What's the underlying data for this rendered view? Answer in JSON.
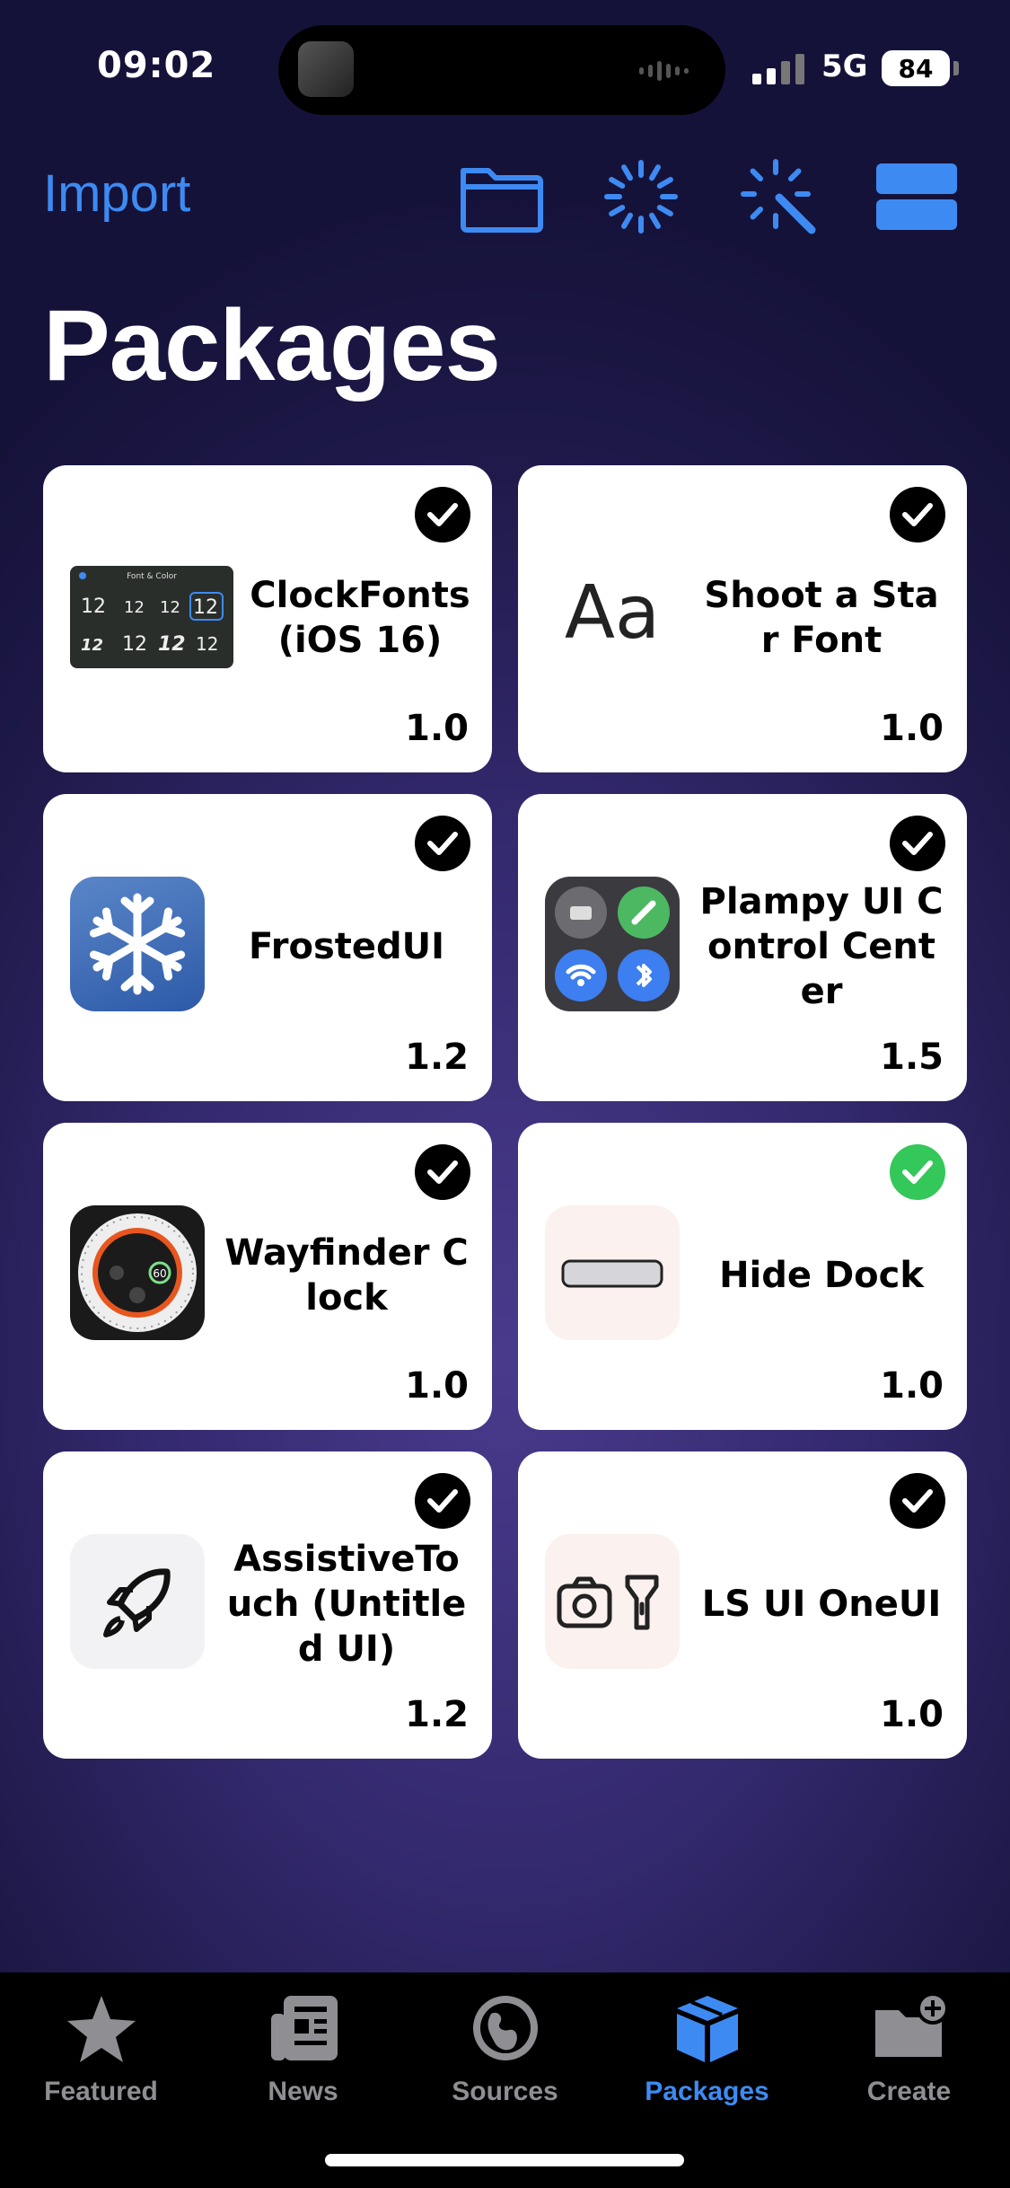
{
  "status": {
    "time": "09:02",
    "network": "5G",
    "battery": "84"
  },
  "header": {
    "import_label": "Import",
    "title": "Packages",
    "icons": [
      "folder-icon",
      "loading-spinner-icon",
      "magic-wand-icon",
      "list-layout-icon"
    ]
  },
  "packages": [
    {
      "name": "ClockFonts (iOS 16)",
      "version": "1.0",
      "icon": "clock-fonts-thumbnail",
      "enabled_color": "#000000"
    },
    {
      "name": "Shoot a Star Font",
      "version": "1.0",
      "icon": "font-aa-icon",
      "enabled_color": "#000000"
    },
    {
      "name": "FrostedUI",
      "version": "1.2",
      "icon": "snowflake-icon",
      "enabled_color": "#000000"
    },
    {
      "name": "Plampy UI Control Center",
      "version": "1.5",
      "icon": "control-center-icon",
      "enabled_color": "#000000"
    },
    {
      "name": "Wayfinder Clock",
      "version": "1.0",
      "icon": "watch-face-icon",
      "enabled_color": "#000000"
    },
    {
      "name": "Hide Dock",
      "version": "1.0",
      "icon": "dock-bar-icon",
      "enabled_color": "#34c759"
    },
    {
      "name": "AssistiveTouch (Untitled UI)",
      "version": "1.2",
      "icon": "rocket-icon",
      "enabled_color": "#000000"
    },
    {
      "name": "LS UI OneUI",
      "version": "1.0",
      "icon": "camera-flashlight-icon",
      "enabled_color": "#000000"
    }
  ],
  "tabs": [
    {
      "label": "Featured",
      "icon": "star-icon",
      "active": false
    },
    {
      "label": "News",
      "icon": "newspaper-icon",
      "active": false
    },
    {
      "label": "Sources",
      "icon": "globe-icon",
      "active": false
    },
    {
      "label": "Packages",
      "icon": "package-box-icon",
      "active": true
    },
    {
      "label": "Create",
      "icon": "folder-plus-icon",
      "active": false
    }
  ],
  "colors": {
    "accent": "#3d8bf2",
    "inactive": "#8e8e93",
    "enabled_green": "#34c759"
  }
}
